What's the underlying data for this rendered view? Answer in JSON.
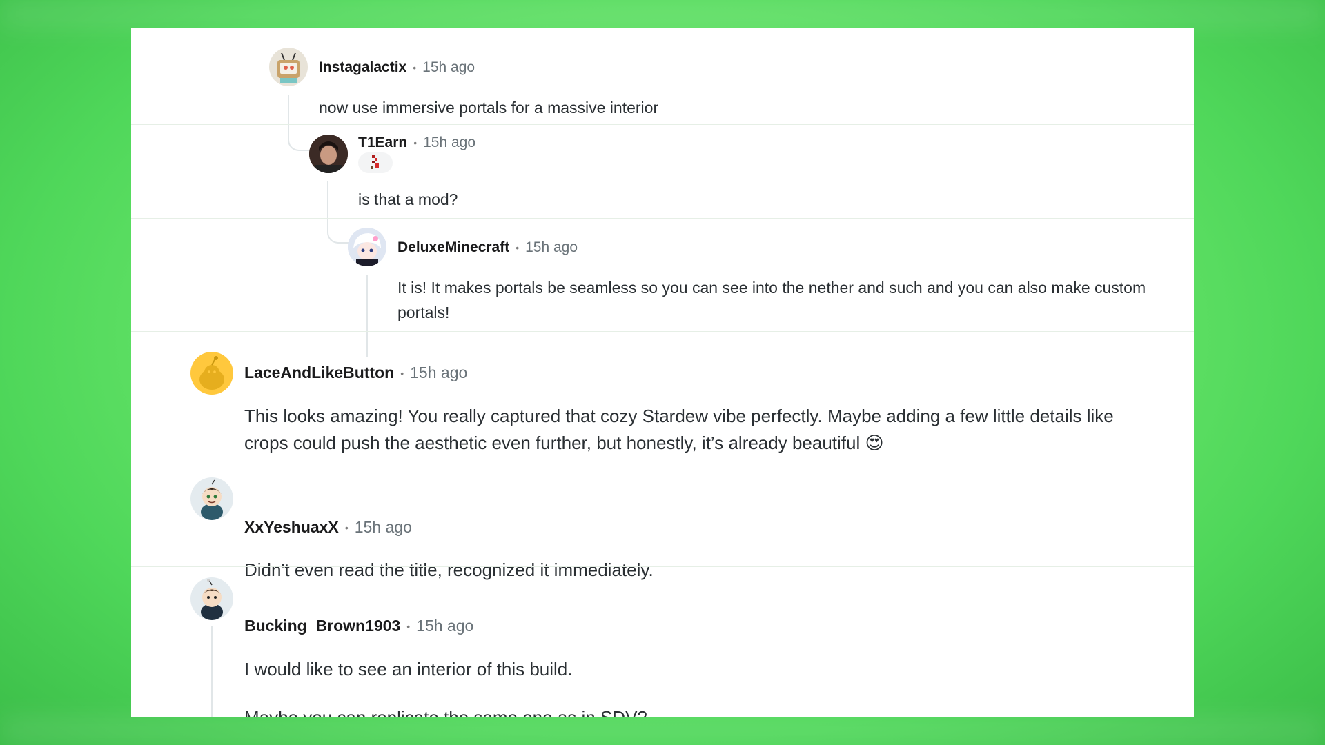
{
  "comments": [
    {
      "author": "Instagalactix",
      "time": "15h ago",
      "body": "now use immersive portals for a massive interior"
    },
    {
      "author": "T1Earn",
      "time": "15h ago",
      "body": "is that a mod?"
    },
    {
      "author": "DeluxeMinecraft",
      "time": "15h ago",
      "body": "It is! It makes portals be seamless so you can see into the nether and such and you can also make custom portals!"
    },
    {
      "author": "LaceAndLikeButton",
      "time": "15h ago",
      "body": "This looks amazing! You really captured that cozy Stardew vibe perfectly. Maybe adding a few little details like crops could push the aesthetic even further, but honestly, it’s already beautiful 😍"
    },
    {
      "author": "XxYeshuaxX",
      "time": "15h ago",
      "body": "Didn't even read the title, recognized it immediately."
    },
    {
      "author": "Bucking_Brown1903",
      "time": "15h ago",
      "body": "I would like to see an interior of this build.",
      "body2": "Maybe you can replicate the same one as in SDV?"
    }
  ],
  "separator": "•",
  "colors": {
    "background": "#6ee86e",
    "panel": "#ffffff",
    "avatar_yellow": "#ffc83d"
  }
}
